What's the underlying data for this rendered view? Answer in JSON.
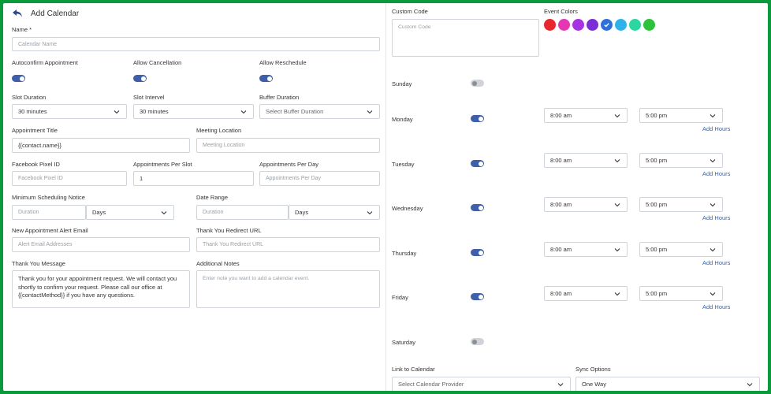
{
  "header": {
    "title": "Add Calendar"
  },
  "form": {
    "name_label": "Name *",
    "name_placeholder": "Calendar Name",
    "autoconfirm_label": "Autoconfirm Appointment",
    "allow_cancellation_label": "Allow Cancellation",
    "allow_reschedule_label": "Allow Reschedule",
    "slot_duration_label": "Slot Duration",
    "slot_duration_value": "30 minutes",
    "slot_interval_label": "Slot Intervel",
    "slot_interval_value": "30 minutes",
    "buffer_duration_label": "Buffer Duration",
    "buffer_duration_value": "Select Buffer Duration",
    "appointment_title_label": "Appointment Title",
    "appointment_title_value": "{{contact.name}}",
    "meeting_location_label": "Meeting Location",
    "meeting_location_placeholder": "Meeting Location",
    "facebook_pixel_label": "Facebook Pixel ID",
    "facebook_pixel_placeholder": "Facebook Pixel ID",
    "appts_per_slot_label": "Appointments Per Slot",
    "appts_per_slot_value": "1",
    "appts_per_day_label": "Appointments Per Day",
    "appts_per_day_placeholder": "Appointments Per Day",
    "min_notice_label": "Minimum Scheduling Notice",
    "min_notice_placeholder": "Duration",
    "min_notice_unit": "Days",
    "date_range_label": "Date Range",
    "date_range_placeholder": "Duration",
    "date_range_unit": "Days",
    "alert_email_label": "New Appointment Alert Email",
    "alert_email_placeholder": "Alert Email Addresses",
    "redirect_url_label": "Thank You Redirect URL",
    "redirect_url_placeholder": "Thank You Redirect URL",
    "thank_you_label": "Thank You Message",
    "thank_you_value": "Thank you for your appointment request. We will contact you shortly to confirm your request. Please call our office at {{contactMethod}} if you have any questions.",
    "notes_label": "Additional Notes",
    "notes_placeholder": "Enter note you want to add a calendar event."
  },
  "right": {
    "custom_code_label": "Custom Code",
    "custom_code_placeholder": "Custom Code",
    "event_colors_label": "Event Colors",
    "colors": [
      "#e8262e",
      "#e536b4",
      "#a533e0",
      "#7a2fd6",
      "#2f6fd9",
      "#2fb1ea",
      "#2cd6a0",
      "#2cc23d"
    ],
    "selected_color_index": 4,
    "add_hours_label": "Add Hours",
    "days": [
      {
        "name": "Sunday",
        "enabled": false
      },
      {
        "name": "Monday",
        "enabled": true,
        "start": "8:00 am",
        "end": "5:00 pm"
      },
      {
        "name": "Tuesday",
        "enabled": true,
        "start": "8:00 am",
        "end": "5:00 pm"
      },
      {
        "name": "Wednesday",
        "enabled": true,
        "start": "8:00 am",
        "end": "5:00 pm"
      },
      {
        "name": "Thursday",
        "enabled": true,
        "start": "8:00 am",
        "end": "5:00 pm"
      },
      {
        "name": "Friday",
        "enabled": true,
        "start": "8:00 am",
        "end": "5:00 pm"
      },
      {
        "name": "Saturday",
        "enabled": false
      }
    ],
    "link_calendar_label": "Link to Calendar",
    "link_calendar_value": "Select Calendar Provider",
    "sync_options_label": "Sync Options",
    "sync_options_value": "One Way"
  }
}
